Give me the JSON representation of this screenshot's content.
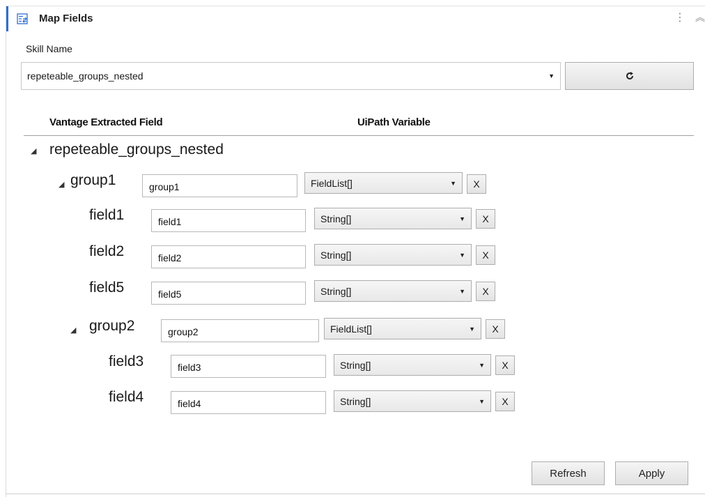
{
  "header": {
    "title": "Map Fields",
    "icon": "mapping-icon"
  },
  "skill": {
    "label": "Skill Name",
    "value": "repeteable_groups_nested"
  },
  "columns": {
    "left": "Vantage Extracted Field",
    "right": "UiPath Variable"
  },
  "tree": {
    "root": "repeteable_groups_nested",
    "group1": {
      "label": "group1",
      "value": "group1",
      "type": "FieldList[]"
    },
    "field1": {
      "label": "field1",
      "value": "field1",
      "type": "String[]"
    },
    "field2": {
      "label": "field2",
      "value": "field2",
      "type": "String[]"
    },
    "field5": {
      "label": "field5",
      "value": "field5",
      "type": "String[]"
    },
    "group2": {
      "label": "group2",
      "value": "group2",
      "type": "FieldList[]"
    },
    "field3": {
      "label": "field3",
      "value": "field3",
      "type": "String[]"
    },
    "field4": {
      "label": "field4",
      "value": "field4",
      "type": "String[]"
    }
  },
  "remove_label": "X",
  "footer": {
    "refresh": "Refresh",
    "apply": "Apply"
  },
  "colors": {
    "accent": "#2f6fd0",
    "border": "#adadad"
  }
}
